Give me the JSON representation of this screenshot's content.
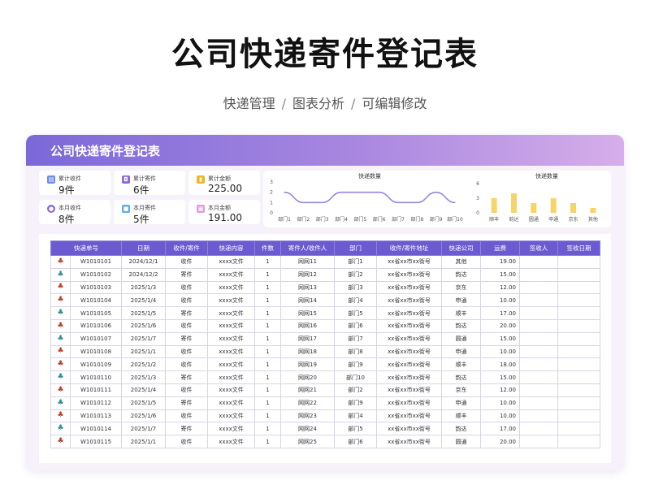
{
  "page": {
    "title": "公司快递寄件登记表",
    "subtitle_parts": [
      "快递管理",
      "图表分析",
      "可编辑修改"
    ],
    "separator": "/"
  },
  "card": {
    "header": "公司快递寄件登记表"
  },
  "stats": [
    {
      "label": "累计收件",
      "value": "9件",
      "color": "#6c8ce8",
      "icon": "inbox-icon"
    },
    {
      "label": "累计寄件",
      "value": "6件",
      "color": "#8a6ad8",
      "icon": "send-icon"
    },
    {
      "label": "累计金额",
      "value": "225.00",
      "color": "#f0b429",
      "icon": "money-icon"
    },
    {
      "label": "本月收件",
      "value": "8件",
      "color": "#8a6ad8",
      "icon": "location-icon"
    },
    {
      "label": "本月寄件",
      "value": "5件",
      "color": "#5aaee8",
      "icon": "package-icon"
    },
    {
      "label": "本月金额",
      "value": "191.00",
      "color": "#e59ad8",
      "icon": "wallet-icon"
    }
  ],
  "chart_data": [
    {
      "type": "line",
      "title": "快递数量",
      "categories": [
        "部门1",
        "部门2",
        "部门3",
        "部门4",
        "部门5",
        "部门6",
        "部门7",
        "部门8",
        "部门9",
        "部门10"
      ],
      "values": [
        2,
        1,
        1,
        2,
        2,
        2,
        1,
        1,
        2,
        1
      ],
      "ylim": [
        0,
        3
      ],
      "yticks": [
        "0",
        "1",
        "2",
        "3"
      ],
      "color": "#9b86d6"
    },
    {
      "type": "bar",
      "title": "快递数量",
      "categories": [
        "顺丰",
        "韵达",
        "圆通",
        "申通",
        "京东",
        "其他"
      ],
      "values": [
        3,
        4,
        2,
        3,
        2,
        1
      ],
      "ylim": [
        0,
        6
      ],
      "yticks": [
        "0",
        "3",
        "6"
      ],
      "color": "#f7d36b"
    }
  ],
  "table": {
    "headers": [
      "快递单号",
      "日期",
      "收件/寄件",
      "快递内容",
      "件数",
      "寄件人/收件人",
      "部门",
      "收件/寄件地址",
      "快递公司",
      "运费",
      "签收人",
      "签收日期"
    ],
    "rows": [
      {
        "icon": "red",
        "no": "W1010101",
        "date": "2024/12/1",
        "type": "收件",
        "content": "xxxx文件",
        "qty": "1",
        "person": "网网11",
        "dept": "部门1",
        "addr": "xx省xx市xx街号",
        "company": "其他",
        "fee": "19.00"
      },
      {
        "icon": "teal",
        "no": "W1010102",
        "date": "2024/12/2",
        "type": "寄件",
        "content": "xxxx文件",
        "qty": "1",
        "person": "网网12",
        "dept": "部门2",
        "addr": "xx省xx市xx街号",
        "company": "韵达",
        "fee": "15.00"
      },
      {
        "icon": "red",
        "no": "W1010103",
        "date": "2025/1/3",
        "type": "收件",
        "content": "xxxx文件",
        "qty": "1",
        "person": "网网13",
        "dept": "部门3",
        "addr": "xx省xx市xx街号",
        "company": "京东",
        "fee": "12.00"
      },
      {
        "icon": "red",
        "no": "W1010104",
        "date": "2025/1/4",
        "type": "收件",
        "content": "xxxx文件",
        "qty": "1",
        "person": "网网14",
        "dept": "部门4",
        "addr": "xx省xx市xx街号",
        "company": "申通",
        "fee": "10.00"
      },
      {
        "icon": "teal",
        "no": "W1010105",
        "date": "2025/1/5",
        "type": "寄件",
        "content": "xxxx文件",
        "qty": "1",
        "person": "网网15",
        "dept": "部门5",
        "addr": "xx省xx市xx街号",
        "company": "顺丰",
        "fee": "17.00"
      },
      {
        "icon": "red",
        "no": "W1010106",
        "date": "2025/1/6",
        "type": "收件",
        "content": "xxxx文件",
        "qty": "1",
        "person": "网网16",
        "dept": "部门6",
        "addr": "xx省xx市xx街号",
        "company": "韵达",
        "fee": "20.00"
      },
      {
        "icon": "teal",
        "no": "W1010107",
        "date": "2025/1/7",
        "type": "寄件",
        "content": "xxxx文件",
        "qty": "1",
        "person": "网网17",
        "dept": "部门7",
        "addr": "xx省xx市xx街号",
        "company": "圆通",
        "fee": "15.00"
      },
      {
        "icon": "red",
        "no": "W1010108",
        "date": "2025/1/1",
        "type": "收件",
        "content": "xxxx文件",
        "qty": "1",
        "person": "网网18",
        "dept": "部门8",
        "addr": "xx省xx市xx街号",
        "company": "申通",
        "fee": "10.00"
      },
      {
        "icon": "red",
        "no": "W1010109",
        "date": "2025/1/2",
        "type": "收件",
        "content": "xxxx文件",
        "qty": "1",
        "person": "网网19",
        "dept": "部门9",
        "addr": "xx省xx市xx街号",
        "company": "顺丰",
        "fee": "18.00"
      },
      {
        "icon": "teal",
        "no": "W1010110",
        "date": "2025/1/3",
        "type": "寄件",
        "content": "xxxx文件",
        "qty": "1",
        "person": "网网20",
        "dept": "部门10",
        "addr": "xx省xx市xx街号",
        "company": "韵达",
        "fee": "15.00"
      },
      {
        "icon": "red",
        "no": "W1010111",
        "date": "2025/1/4",
        "type": "收件",
        "content": "xxxx文件",
        "qty": "1",
        "person": "网网21",
        "dept": "部门2",
        "addr": "xx省xx市xx街号",
        "company": "京东",
        "fee": "12.00"
      },
      {
        "icon": "teal",
        "no": "W1010112",
        "date": "2025/1/5",
        "type": "寄件",
        "content": "xxxx文件",
        "qty": "1",
        "person": "网网22",
        "dept": "部门9",
        "addr": "xx省xx市xx街号",
        "company": "申通",
        "fee": "10.00"
      },
      {
        "icon": "red",
        "no": "W1010113",
        "date": "2025/1/6",
        "type": "收件",
        "content": "xxxx文件",
        "qty": "1",
        "person": "网网23",
        "dept": "部门4",
        "addr": "xx省xx市xx街号",
        "company": "顺丰",
        "fee": "10.00"
      },
      {
        "icon": "teal",
        "no": "W1010114",
        "date": "2025/1/7",
        "type": "寄件",
        "content": "xxxx文件",
        "qty": "1",
        "person": "网网24",
        "dept": "部门5",
        "addr": "xx省xx市xx街号",
        "company": "韵达",
        "fee": "17.00"
      },
      {
        "icon": "red",
        "no": "W1010115",
        "date": "2025/1/1",
        "type": "收件",
        "content": "xxxx文件",
        "qty": "1",
        "person": "网网25",
        "dept": "部门6",
        "addr": "xx省xx市xx街号",
        "company": "圆通",
        "fee": "20.00"
      }
    ]
  }
}
